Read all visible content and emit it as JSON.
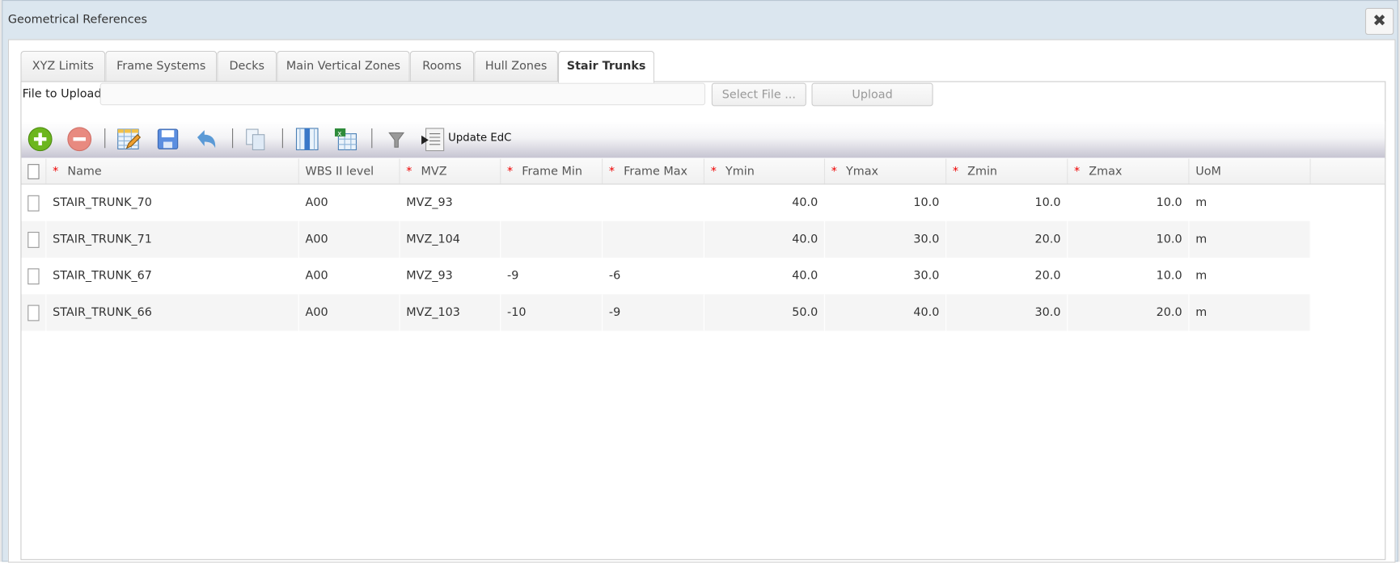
{
  "window": {
    "title": "Geometrical References",
    "close_icon": "close-icon"
  },
  "tabs": [
    {
      "label": "XYZ Limits",
      "active": false
    },
    {
      "label": "Frame Systems",
      "active": false
    },
    {
      "label": "Decks",
      "active": false
    },
    {
      "label": "Main Vertical Zones",
      "active": false
    },
    {
      "label": "Rooms",
      "active": false
    },
    {
      "label": "Hull Zones",
      "active": false
    },
    {
      "label": "Stair Trunks",
      "active": true
    }
  ],
  "upload": {
    "label": "File to Upload",
    "value": "",
    "select_label": "Select File ...",
    "upload_label": "Upload"
  },
  "toolbar": {
    "update_label": "Update EdC",
    "icons": [
      "add-icon",
      "remove-icon",
      "edit-table-icon",
      "save-icon",
      "undo-icon",
      "copy-icon",
      "columns-icon",
      "excel-export-icon",
      "filter-icon",
      "update-edc-icon"
    ]
  },
  "colors": {
    "required": "#ee0000",
    "add": "#6cb61e",
    "remove": "#e88a80"
  },
  "grid": {
    "columns": [
      {
        "label": "Name",
        "required": true
      },
      {
        "label": "WBS II level",
        "required": false
      },
      {
        "label": "MVZ",
        "required": true
      },
      {
        "label": "Frame Min",
        "required": true
      },
      {
        "label": "Frame Max",
        "required": true
      },
      {
        "label": "Ymin",
        "required": true
      },
      {
        "label": "Ymax",
        "required": true
      },
      {
        "label": "Zmin",
        "required": true
      },
      {
        "label": "Zmax",
        "required": true
      },
      {
        "label": "UoM",
        "required": false
      }
    ],
    "rows": [
      [
        "STAIR_TRUNK_70",
        "A00",
        "MVZ_93",
        "",
        "",
        "40.0",
        "10.0",
        "10.0",
        "10.0",
        "m"
      ],
      [
        "STAIR_TRUNK_71",
        "A00",
        "MVZ_104",
        "",
        "",
        "40.0",
        "30.0",
        "20.0",
        "10.0",
        "m"
      ],
      [
        "STAIR_TRUNK_67",
        "A00",
        "MVZ_93",
        "-9",
        "-6",
        "40.0",
        "30.0",
        "20.0",
        "10.0",
        "m"
      ],
      [
        "STAIR_TRUNK_66",
        "A00",
        "MVZ_103",
        "-10",
        "-9",
        "50.0",
        "40.0",
        "30.0",
        "20.0",
        "m"
      ]
    ]
  }
}
